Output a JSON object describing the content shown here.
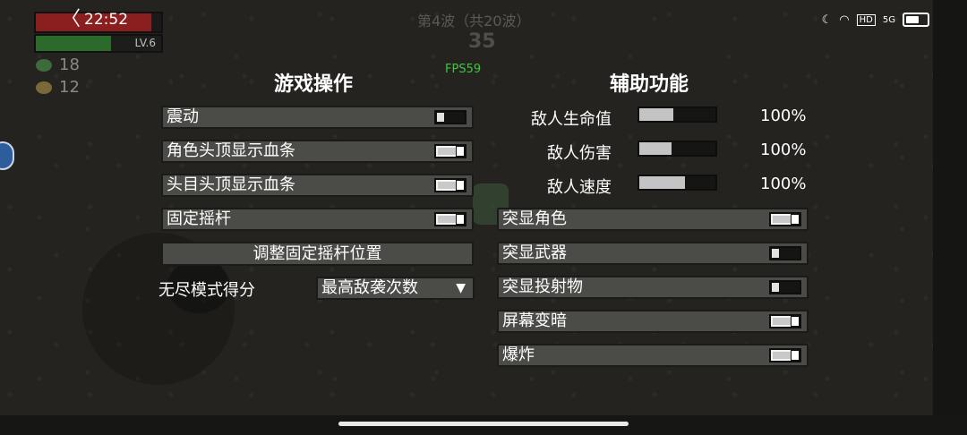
{
  "status_bar": {
    "back_chevron": "〈",
    "time": "22:52",
    "network_label": "5G",
    "hd_label": "HD"
  },
  "hud": {
    "hp_fraction": 0.92,
    "xp_fraction": 0.6,
    "level_label": "LV.6",
    "materials": "18",
    "bag": "12",
    "wave_label": "第4波（共20波）",
    "wave_timer": "35",
    "fps_label": "FPS59"
  },
  "colors": {
    "accent_fps": "#3fc63f",
    "panel_row": "#4b4b47",
    "hp": "#8b1e1e",
    "xp": "#2b6a2b"
  },
  "game_controls": {
    "title": "游戏操作",
    "toggles": [
      {
        "label": "震动",
        "on": false
      },
      {
        "label": "角色头顶显示血条",
        "on": true
      },
      {
        "label": "头目头顶显示血条",
        "on": true
      },
      {
        "label": "固定摇杆",
        "on": true
      }
    ],
    "adjust_button": "调整固定摇杆位置",
    "endless_label": "无尽模式得分",
    "endless_select": "最高敌袭次数"
  },
  "assist": {
    "title": "辅助功能",
    "sliders": [
      {
        "label": "敌人生命值",
        "fraction": 0.45,
        "value": "100%"
      },
      {
        "label": "敌人伤害",
        "fraction": 0.42,
        "value": "100%"
      },
      {
        "label": "敌人速度",
        "fraction": 0.6,
        "value": "100%"
      }
    ],
    "toggles": [
      {
        "label": "突显角色",
        "on": true
      },
      {
        "label": "突显武器",
        "on": false
      },
      {
        "label": "突显投射物",
        "on": false
      },
      {
        "label": "屏幕变暗",
        "on": true
      },
      {
        "label": "爆炸",
        "on": true
      }
    ]
  }
}
